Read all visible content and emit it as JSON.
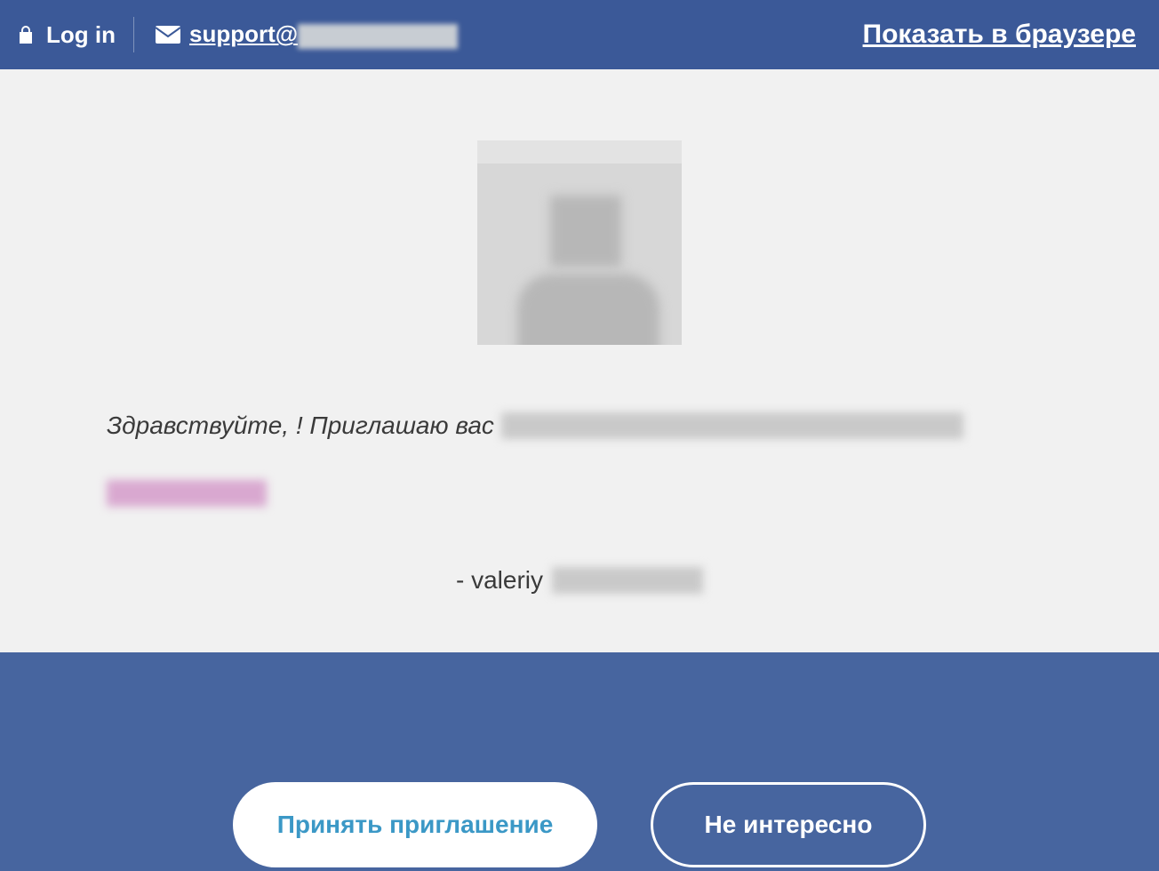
{
  "header": {
    "login_label": "Log in",
    "support_prefix": "support@",
    "browser_link_label": "Показать в браузере"
  },
  "message": {
    "greeting": "Здравствуйте, ! Приглашаю вас",
    "signature_prefix": "- valeriy"
  },
  "actions": {
    "accept_label": "Принять приглашение",
    "decline_label": "Не интересно"
  }
}
